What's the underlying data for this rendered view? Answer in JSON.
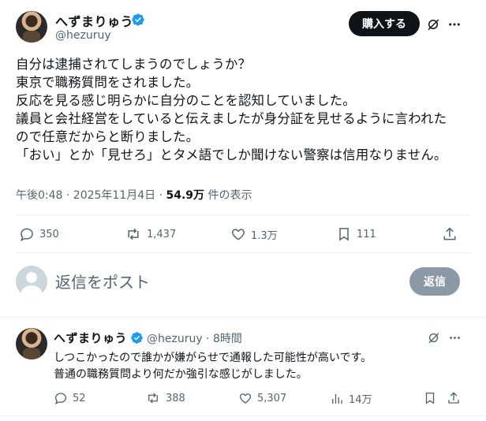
{
  "main_tweet": {
    "author_name": "へずまりゅう",
    "author_handle": "@hezuruy",
    "buy_button": "購入する",
    "lines": [
      "自分は逮捕されてしまうのでしょうか？",
      "東京で職務質問をされました。",
      "反応を見る感じ明らかに自分のことを認知していました。",
      "議員と会社経営をしていると伝えましたが身分証を見せるように言われた",
      "ので任意だからと断りました。",
      "「おい」とか「見せろ」とタメ語でしか聞けない警察は信用なりません。"
    ],
    "timestamp": "午後0:48 · 2025年11月4日 · ",
    "views_count": "54.9万",
    "views_label": " 件の表示",
    "stats": {
      "replies": "350",
      "reposts": "1,437",
      "likes": "1.3万",
      "bookmarks": "111"
    }
  },
  "reply_composer": {
    "placeholder": "返信をポスト",
    "button": "返信"
  },
  "reply_tweet": {
    "author_name": "へずまりゅう",
    "author_meta": "@hezuruy · 8時間",
    "lines": [
      "しつこかったので誰かが嫌がらせで通報した可能性が高いです。",
      "普通の職務質問より何だか強引な感じがしました。"
    ],
    "stats": {
      "replies": "52",
      "reposts": "388",
      "likes": "5,307",
      "views": "14万"
    }
  },
  "colors": {
    "verified": "#1d9bf0",
    "text": "#0f1419",
    "muted": "#536471",
    "reply_button": "#8b98a5"
  }
}
